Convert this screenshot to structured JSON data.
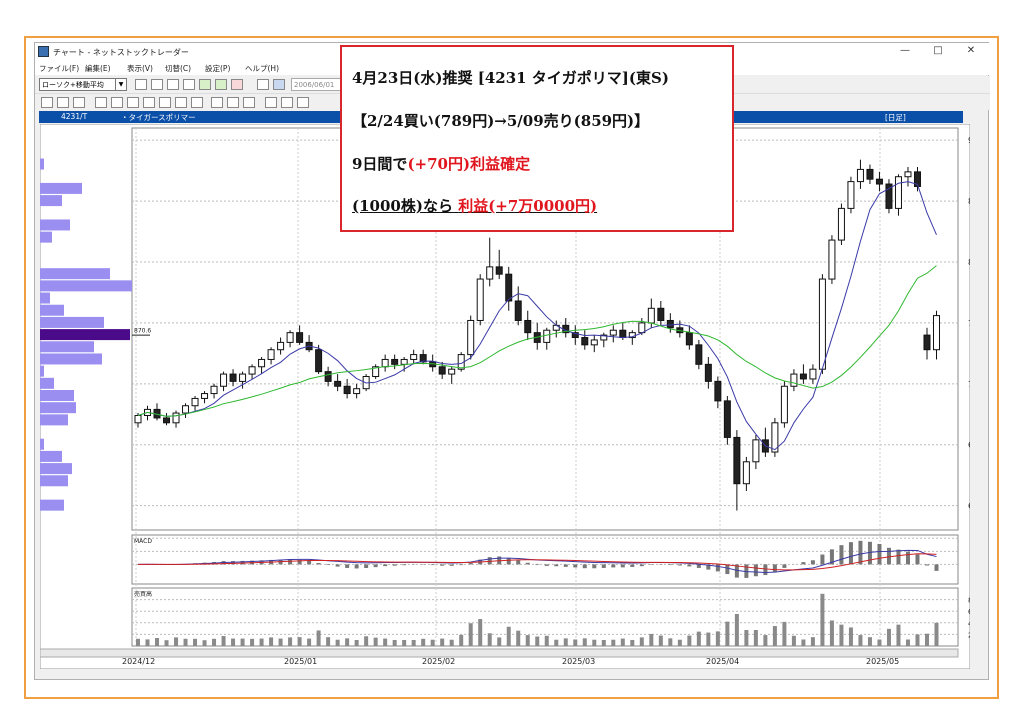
{
  "window": {
    "title": "チャート - ネットストックトレーダー",
    "controls": [
      "—",
      "□",
      "✕"
    ]
  },
  "menu": [
    "ファイル(F)",
    "編集(E)",
    "表示(V)",
    "切替(C)",
    "設定(P)",
    "ヘルプ(H)"
  ],
  "toolbar": {
    "indicator_select": "ローソク+移動平均",
    "date_field": "2006/06/01"
  },
  "header": {
    "code": "4231/T",
    "name": "・タイガースポリマー",
    "period": "[日足]"
  },
  "overlay": {
    "line1": "4月23日(水)推奨 [4231 タイガポリマ](東S)",
    "line2": "【2/24買い(789円)→5/09売り(859円)】",
    "line3_prefix": "9日間で",
    "line3_highlight": "(+70円)利益確定",
    "line4_prefix": "(1000株)なら",
    "line4_highlight": "利益(+7万0000円)"
  },
  "icons": {
    "app": "app-icon",
    "minimize": "minimize-icon",
    "maximize": "maximize-icon",
    "close": "close-icon"
  },
  "colors": {
    "ma_short": "#3a3aa8",
    "ma_long": "#2fb82f",
    "macd": "#3a3aa8",
    "signal": "#d02020",
    "volume_profile": "#9a8ef0",
    "volume_profile_peak": "#4a0a8a",
    "overlay_border": "#d8262c",
    "accent_red": "#e0151d",
    "accent_blue": "#1a5fd0"
  },
  "chart_data": {
    "type": "candlestick",
    "price_axis": {
      "min": 580,
      "max": 910,
      "ticks": [
        600,
        650,
        700,
        750,
        800,
        850,
        900
      ]
    },
    "x_labels": [
      "2024/12",
      "2025/01",
      "2025/02",
      "2025/03",
      "2025/04",
      "2025/05"
    ],
    "price_line_label": "870.6",
    "macd": {
      "label": "MACD",
      "ticks": [
        80,
        40,
        0
      ],
      "range": [
        -60,
        90
      ]
    },
    "volume": {
      "label": "売買高",
      "ticks": [
        800,
        600,
        400,
        200
      ],
      "range": [
        0,
        1000
      ]
    },
    "candles": [
      [
        668,
        676,
        664,
        674
      ],
      [
        674,
        682,
        670,
        679
      ],
      [
        679,
        684,
        670,
        672
      ],
      [
        672,
        676,
        666,
        668
      ],
      [
        668,
        678,
        664,
        676
      ],
      [
        676,
        684,
        672,
        682
      ],
      [
        682,
        690,
        678,
        688
      ],
      [
        688,
        694,
        684,
        692
      ],
      [
        692,
        700,
        688,
        698
      ],
      [
        698,
        710,
        694,
        708
      ],
      [
        708,
        712,
        698,
        702
      ],
      [
        702,
        710,
        696,
        708
      ],
      [
        708,
        716,
        704,
        714
      ],
      [
        714,
        722,
        708,
        720
      ],
      [
        720,
        730,
        716,
        728
      ],
      [
        728,
        738,
        724,
        734
      ],
      [
        734,
        744,
        730,
        742
      ],
      [
        742,
        748,
        732,
        734
      ],
      [
        734,
        740,
        726,
        728
      ],
      [
        728,
        732,
        708,
        710
      ],
      [
        710,
        714,
        698,
        702
      ],
      [
        702,
        708,
        694,
        698
      ],
      [
        698,
        704,
        688,
        692
      ],
      [
        692,
        700,
        688,
        696
      ],
      [
        696,
        708,
        694,
        706
      ],
      [
        706,
        716,
        704,
        714
      ],
      [
        714,
        724,
        710,
        720
      ],
      [
        720,
        724,
        712,
        716
      ],
      [
        716,
        722,
        710,
        720
      ],
      [
        720,
        728,
        716,
        724
      ],
      [
        724,
        728,
        716,
        718
      ],
      [
        718,
        724,
        710,
        714
      ],
      [
        714,
        718,
        704,
        708
      ],
      [
        708,
        714,
        700,
        712
      ],
      [
        712,
        726,
        710,
        724
      ],
      [
        724,
        756,
        720,
        752
      ],
      [
        752,
        790,
        748,
        786
      ],
      [
        786,
        820,
        780,
        796
      ],
      [
        796,
        810,
        786,
        790
      ],
      [
        790,
        796,
        760,
        768
      ],
      [
        768,
        780,
        748,
        752
      ],
      [
        752,
        760,
        736,
        742
      ],
      [
        742,
        750,
        728,
        734
      ],
      [
        734,
        746,
        728,
        744
      ],
      [
        744,
        752,
        738,
        748
      ],
      [
        748,
        754,
        738,
        742
      ],
      [
        742,
        748,
        732,
        738
      ],
      [
        738,
        744,
        728,
        732
      ],
      [
        732,
        740,
        726,
        736
      ],
      [
        736,
        742,
        730,
        740
      ],
      [
        740,
        748,
        734,
        744
      ],
      [
        744,
        750,
        736,
        738
      ],
      [
        738,
        744,
        732,
        742
      ],
      [
        742,
        754,
        740,
        750
      ],
      [
        750,
        770,
        746,
        762
      ],
      [
        762,
        768,
        748,
        752
      ],
      [
        752,
        758,
        742,
        746
      ],
      [
        746,
        752,
        738,
        742
      ],
      [
        742,
        748,
        728,
        732
      ],
      [
        732,
        736,
        712,
        716
      ],
      [
        716,
        722,
        696,
        702
      ],
      [
        702,
        706,
        680,
        686
      ],
      [
        686,
        690,
        650,
        656
      ],
      [
        656,
        662,
        596,
        618
      ],
      [
        618,
        640,
        612,
        636
      ],
      [
        636,
        658,
        630,
        654
      ],
      [
        654,
        664,
        640,
        644
      ],
      [
        644,
        672,
        640,
        668
      ],
      [
        668,
        702,
        664,
        698
      ],
      [
        698,
        712,
        694,
        708
      ],
      [
        708,
        716,
        700,
        704
      ],
      [
        704,
        716,
        700,
        712
      ],
      [
        712,
        790,
        708,
        786
      ],
      [
        786,
        822,
        782,
        818
      ],
      [
        818,
        848,
        814,
        844
      ],
      [
        844,
        870,
        840,
        866
      ],
      [
        866,
        884,
        860,
        876
      ],
      [
        876,
        880,
        864,
        868
      ],
      [
        868,
        874,
        858,
        864
      ],
      [
        864,
        868,
        840,
        844
      ],
      [
        844,
        872,
        838,
        870
      ],
      [
        870,
        878,
        862,
        874
      ],
      [
        874,
        878,
        858,
        862
      ],
      [
        740,
        746,
        720,
        728
      ],
      [
        728,
        760,
        720,
        756
      ]
    ]
  }
}
